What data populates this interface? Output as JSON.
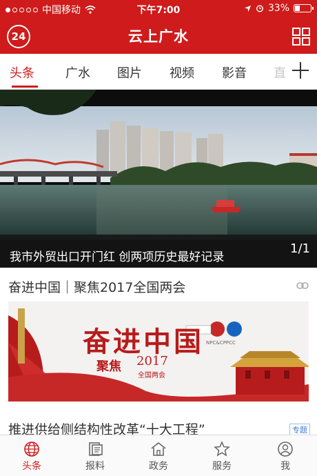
{
  "status_bar": {
    "carrier": "中国移动",
    "time": "下午7:00",
    "battery": "33%",
    "battery_level": 0.33
  },
  "header": {
    "logo_text": "24",
    "title": "云上广水"
  },
  "tabs": [
    {
      "label": "头条",
      "active": true
    },
    {
      "label": "广水"
    },
    {
      "label": "图片"
    },
    {
      "label": "视频"
    },
    {
      "label": "影音"
    },
    {
      "label": "直"
    }
  ],
  "hero": {
    "caption": "我市外贸出口开门红 创两项历史最好记录",
    "counter": "1/1"
  },
  "feature": {
    "title": "奋进中国｜聚焦2017全国两会",
    "banner": {
      "main": "奋进中国",
      "sub": "聚焦",
      "year": "2017",
      "year_sub": "全国两会",
      "badge": "NPC&CPPCC"
    }
  },
  "next_item": {
    "title": "推进供给侧结构性改革“十大工程”",
    "badge": "专题"
  },
  "bottom_nav": [
    {
      "label": "头条",
      "icon": "globe-icon",
      "active": true
    },
    {
      "label": "报料",
      "icon": "report-icon"
    },
    {
      "label": "政务",
      "icon": "government-icon"
    },
    {
      "label": "服务",
      "icon": "service-icon"
    },
    {
      "label": "我",
      "icon": "user-icon"
    }
  ],
  "colors": {
    "brand": "#cf1b1b",
    "link": "#3a7bd5"
  }
}
